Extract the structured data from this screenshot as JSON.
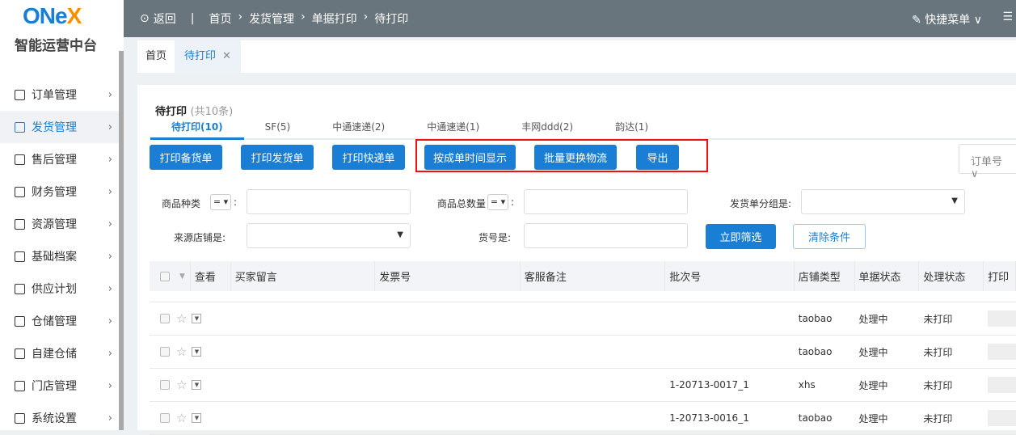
{
  "brand": {
    "logo_a": "ONe",
    "logo_b": "X",
    "name": "智能运营中台"
  },
  "sidebar": {
    "items": [
      {
        "label": "订单管理"
      },
      {
        "label": "发货管理"
      },
      {
        "label": "售后管理"
      },
      {
        "label": "财务管理"
      },
      {
        "label": "资源管理"
      },
      {
        "label": "基础档案"
      },
      {
        "label": "供应计划"
      },
      {
        "label": "仓储管理"
      },
      {
        "label": "自建仓储"
      },
      {
        "label": "门店管理"
      },
      {
        "label": "系统设置"
      }
    ]
  },
  "header": {
    "back": "返回",
    "sep": "|",
    "breadcrumb": [
      "首页",
      "发货管理",
      "单据打印",
      "待打印"
    ],
    "quick_menu": "快捷菜单 ∨",
    "menu_icon": "☰"
  },
  "tabs": [
    {
      "label": "首页"
    },
    {
      "label": "待打印"
    }
  ],
  "page": {
    "title": "待打印",
    "count": "(共10条)"
  },
  "subtabs": [
    "待打印(10)",
    "SF(5)",
    "中通速递(2)",
    "中通速递(1)",
    "丰网ddd(2)",
    "韵达(1)"
  ],
  "buttons": [
    "打印备货单",
    "打印发货单",
    "打印快递单",
    "按成单时间显示",
    "批量更换物流",
    "导出"
  ],
  "sort_select": "订单号 ∨",
  "filters": {
    "goods_kind": "商品种类",
    "goods_total": "商品总数量",
    "op": "=",
    "group": "发货单分组是:",
    "shop": "来源店铺是:",
    "sku": "货号是:",
    "apply": "立即筛选",
    "clear": "清除条件"
  },
  "table": {
    "columns": [
      "查看",
      "买家留言",
      "发票号",
      "客服备注",
      "批次号",
      "店铺类型",
      "单据状态",
      "处理状态",
      "打印"
    ],
    "rows": [
      {
        "batch": "",
        "shop": "taobao",
        "doc": "处理中",
        "proc": "未打印"
      },
      {
        "batch": "",
        "shop": "taobao",
        "doc": "处理中",
        "proc": "未打印"
      },
      {
        "batch": "1-20713-0017_1",
        "shop": "xhs",
        "doc": "处理中",
        "proc": "未打印"
      },
      {
        "batch": "1-20713-0016_1",
        "shop": "taobao",
        "doc": "处理中",
        "proc": "未打印"
      }
    ]
  }
}
